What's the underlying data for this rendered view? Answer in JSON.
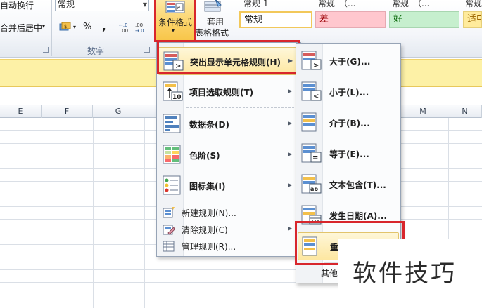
{
  "ribbon": {
    "alignment": {
      "wrap_text": "自动换行",
      "merge_center": "合并后居中"
    },
    "number": {
      "format_value": "常规",
      "percent_symbol": "%",
      "comma_symbol": ",",
      "increase_decimal": ".0→.00",
      "decrease_decimal": ".00→.0",
      "group_label": "数字"
    },
    "styles": {
      "conditional_formatting": "条件格式",
      "format_as_table_line1": "套用",
      "format_as_table_line2": "表格格式",
      "cell_styles": [
        {
          "header": "常规 1",
          "label": "常规",
          "bg": "#ffffff",
          "color": "#1e1e1e"
        },
        {
          "header": "常规_（...",
          "label": "差",
          "bg": "#ffc7ce",
          "color": "#9c0006"
        },
        {
          "header": "常规_（...",
          "label": "好",
          "bg": "#c6efce",
          "color": "#006100"
        },
        {
          "header": "常规",
          "label": "适中",
          "bg": "#ffeb9c",
          "color": "#9c6500"
        }
      ]
    }
  },
  "columns": [
    "E",
    "F",
    "G",
    "M",
    "N"
  ],
  "cf_menu": {
    "items": [
      {
        "label": "突出显示单元格规则(H)",
        "icon": "highlight-cells-rules-icon",
        "submenu": true
      },
      {
        "label": "项目选取规则(T)",
        "icon": "top-bottom-rules-icon",
        "submenu": true
      },
      {
        "label": "数据条(D)",
        "icon": "data-bars-icon",
        "submenu": true
      },
      {
        "label": "色阶(S)",
        "icon": "color-scales-icon",
        "submenu": true
      },
      {
        "label": "图标集(I)",
        "icon": "icon-sets-icon",
        "submenu": true
      },
      {
        "label": "新建规则(N)...",
        "icon": "new-rule-icon",
        "submenu": false
      },
      {
        "label": "清除规则(C)",
        "icon": "clear-rules-icon",
        "submenu": true
      },
      {
        "label": "管理规则(R)...",
        "icon": "manage-rules-icon",
        "submenu": false
      }
    ]
  },
  "highlight_submenu": {
    "items": [
      {
        "label": "大于(G)...",
        "icon": "greater-than-icon"
      },
      {
        "label": "小于(L)...",
        "icon": "less-than-icon"
      },
      {
        "label": "介于(B)...",
        "icon": "between-icon"
      },
      {
        "label": "等于(E)...",
        "icon": "equal-to-icon"
      },
      {
        "label": "文本包含(T)...",
        "icon": "text-contains-icon"
      },
      {
        "label": "发生日期(A)...",
        "icon": "date-occurring-icon"
      },
      {
        "label": "重",
        "icon": "duplicate-values-icon"
      },
      {
        "label": "其他",
        "icon": ""
      }
    ]
  },
  "watermark": "软件技巧",
  "colors": {
    "highlight_border": "#d8262c",
    "message_bar": "#fdf1a6",
    "menu_hover": "#fde7a1"
  }
}
